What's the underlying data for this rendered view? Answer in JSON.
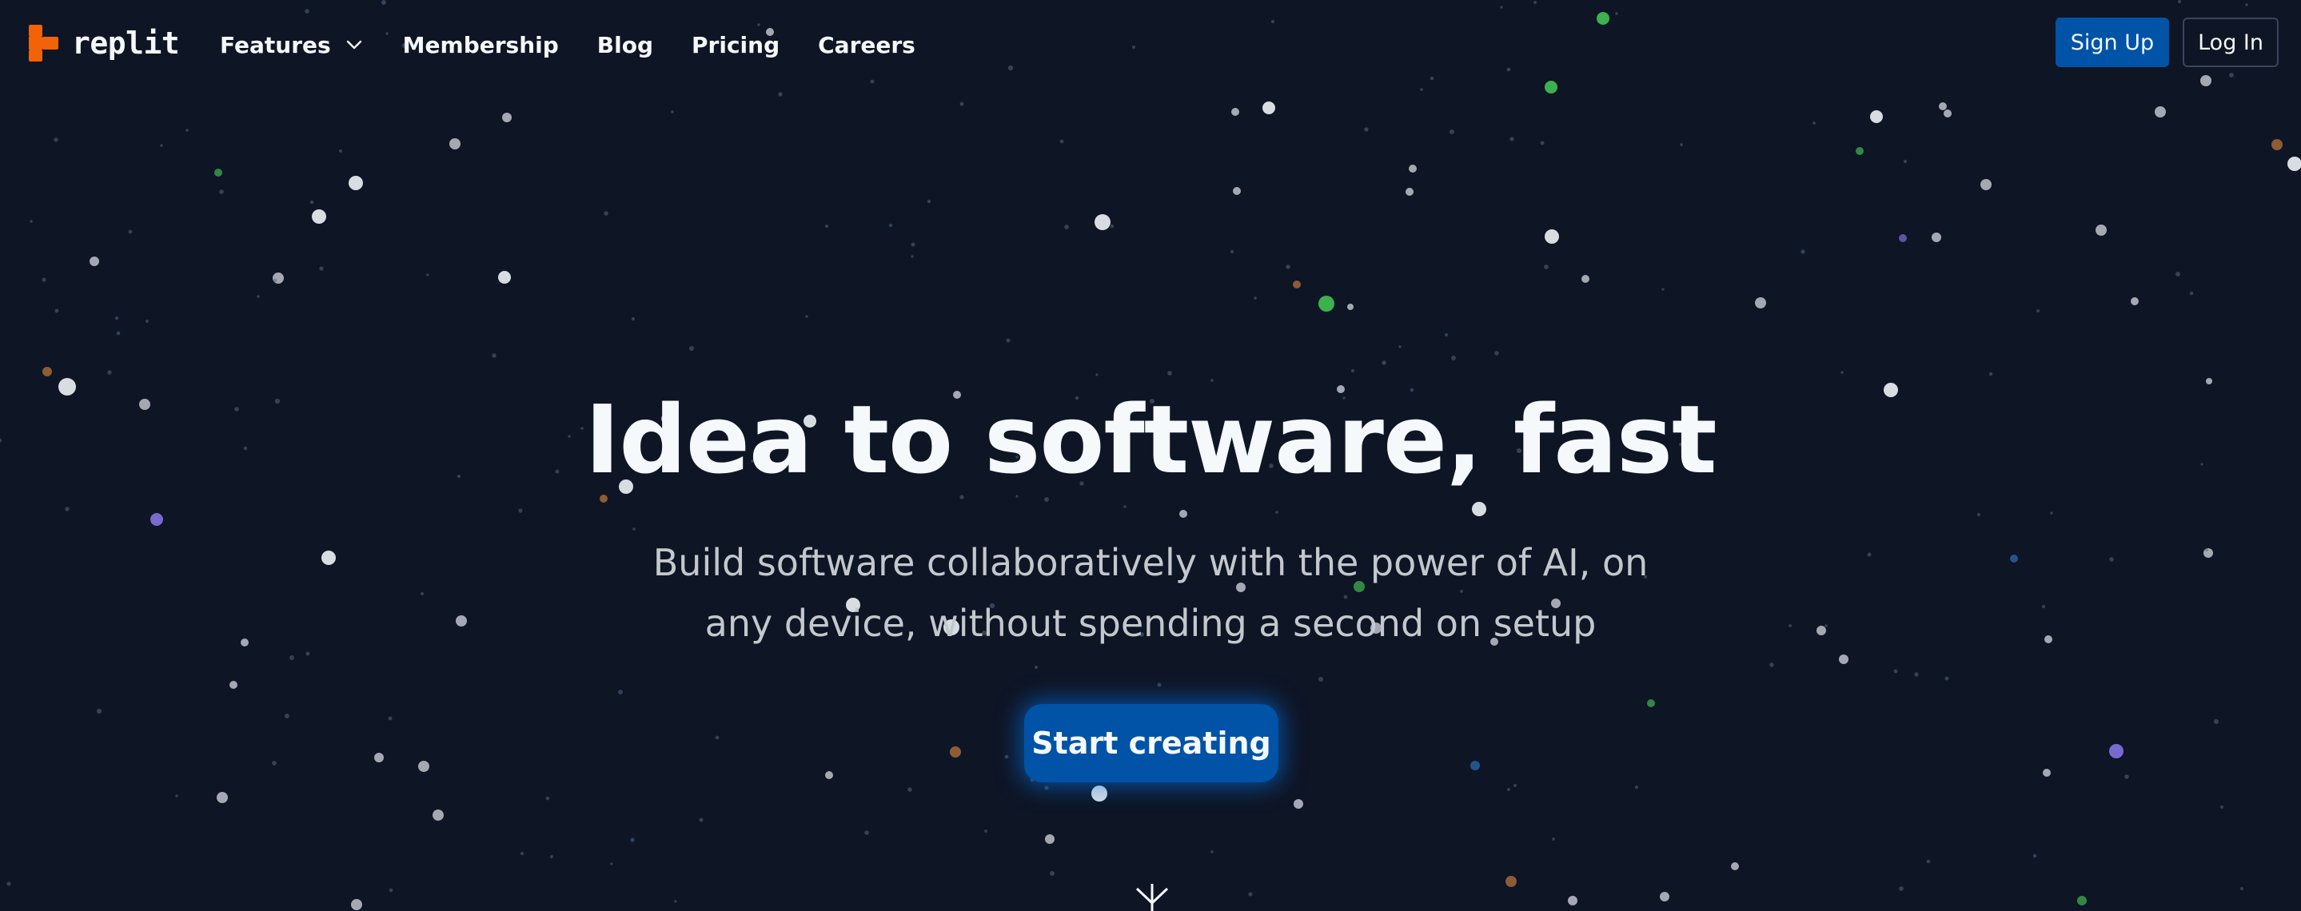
{
  "header": {
    "logo_text": "replit",
    "logo_icon": "replit-logo-icon",
    "nav": [
      {
        "label": "Features",
        "icon": "chevron-down-icon"
      },
      {
        "label": "Membership"
      },
      {
        "label": "Blog"
      },
      {
        "label": "Pricing"
      },
      {
        "label": "Careers"
      }
    ],
    "sign_up_label": "Sign Up",
    "log_in_label": "Log In"
  },
  "hero": {
    "title": "Idea to software, fast",
    "subtitle": "Build software collaboratively with the power of AI, on any device, without spending a second on setup",
    "cta_label": "Start creating"
  },
  "colors": {
    "background": "#0e1525",
    "text_primary": "#f5f9fc",
    "text_secondary": "#c2c8cc",
    "primary_blue": "#0053a6",
    "logo_orange": "#f26207",
    "star_white": "#e4e8ec",
    "star_green": "#3fb950",
    "star_purple": "#7f6fd8",
    "star_orange": "#c27a3c"
  }
}
